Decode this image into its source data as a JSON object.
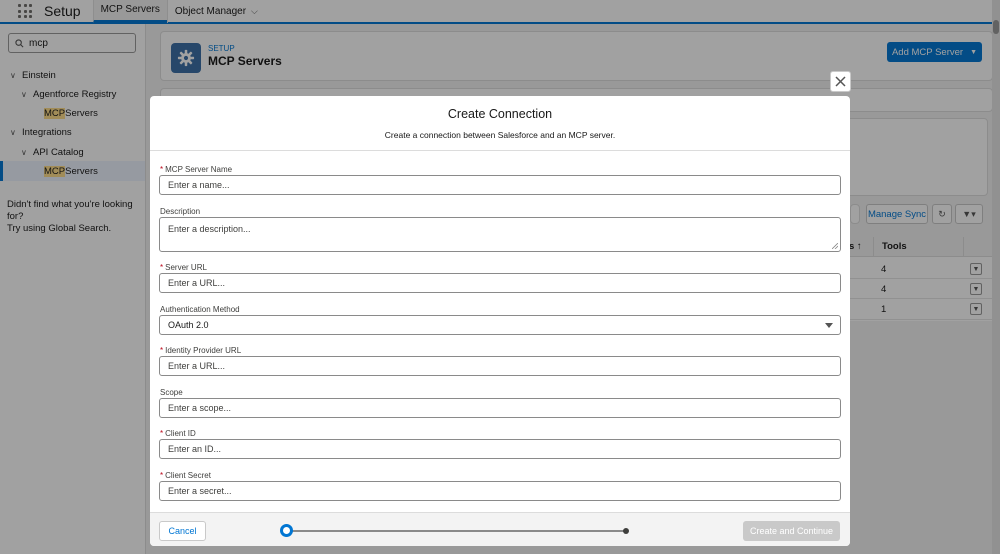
{
  "topbar": {
    "app_name": "Setup",
    "tabs": [
      {
        "label": "MCP Servers",
        "active": true
      },
      {
        "label": "Object Manager",
        "active": false
      }
    ]
  },
  "sidebar": {
    "search_value": "mcp",
    "tree": [
      {
        "label": "Einstein",
        "level": 0
      },
      {
        "label": "Agentforce Registry",
        "level": 1
      },
      {
        "label_highlight": "MCP",
        "label_rest": " Servers",
        "level": 2
      },
      {
        "label": "Integrations",
        "level": 0
      },
      {
        "label": "API Catalog",
        "level": 1
      },
      {
        "label_highlight": "MCP",
        "label_rest": " Servers",
        "level": 2,
        "selected": true
      }
    ],
    "help_line1": "Didn't find what you're looking for?",
    "help_line2": "Try using Global Search."
  },
  "page_header": {
    "kicker": "SETUP",
    "title": "MCP Servers",
    "add_button": "Add MCP Server"
  },
  "list": {
    "manage_sync": "Manage Sync",
    "col_status_partial": "s ↑",
    "col_tools": "Tools",
    "rows": [
      {
        "tools": "4"
      },
      {
        "tools": "4"
      },
      {
        "tools": "1"
      }
    ]
  },
  "modal": {
    "title": "Create Connection",
    "subtitle": "Create a connection between Salesforce and an MCP server.",
    "fields": {
      "server_name": {
        "label": "MCP Server Name",
        "required": true,
        "placeholder": "Enter a name..."
      },
      "description": {
        "label": "Description",
        "required": false,
        "placeholder": "Enter a description..."
      },
      "server_url": {
        "label": "Server URL",
        "required": true,
        "placeholder": "Enter a URL..."
      },
      "auth_method": {
        "label": "Authentication Method",
        "required": false,
        "value": "OAuth 2.0"
      },
      "idp_url": {
        "label": "Identity Provider URL",
        "required": true,
        "placeholder": "Enter a URL..."
      },
      "scope": {
        "label": "Scope",
        "required": false,
        "placeholder": "Enter a scope..."
      },
      "client_id": {
        "label": "Client ID",
        "required": true,
        "placeholder": "Enter an ID..."
      },
      "client_secret": {
        "label": "Client Secret",
        "required": true,
        "placeholder": "Enter a secret..."
      }
    },
    "required_marker": "*",
    "cancel": "Cancel",
    "continue": "Create and Continue",
    "progress": {
      "current_step": 1,
      "total_steps": 2
    }
  },
  "colors": {
    "brand": "#0176d3",
    "required": "#ba0517",
    "disabled_button": "#c9c9c9"
  }
}
